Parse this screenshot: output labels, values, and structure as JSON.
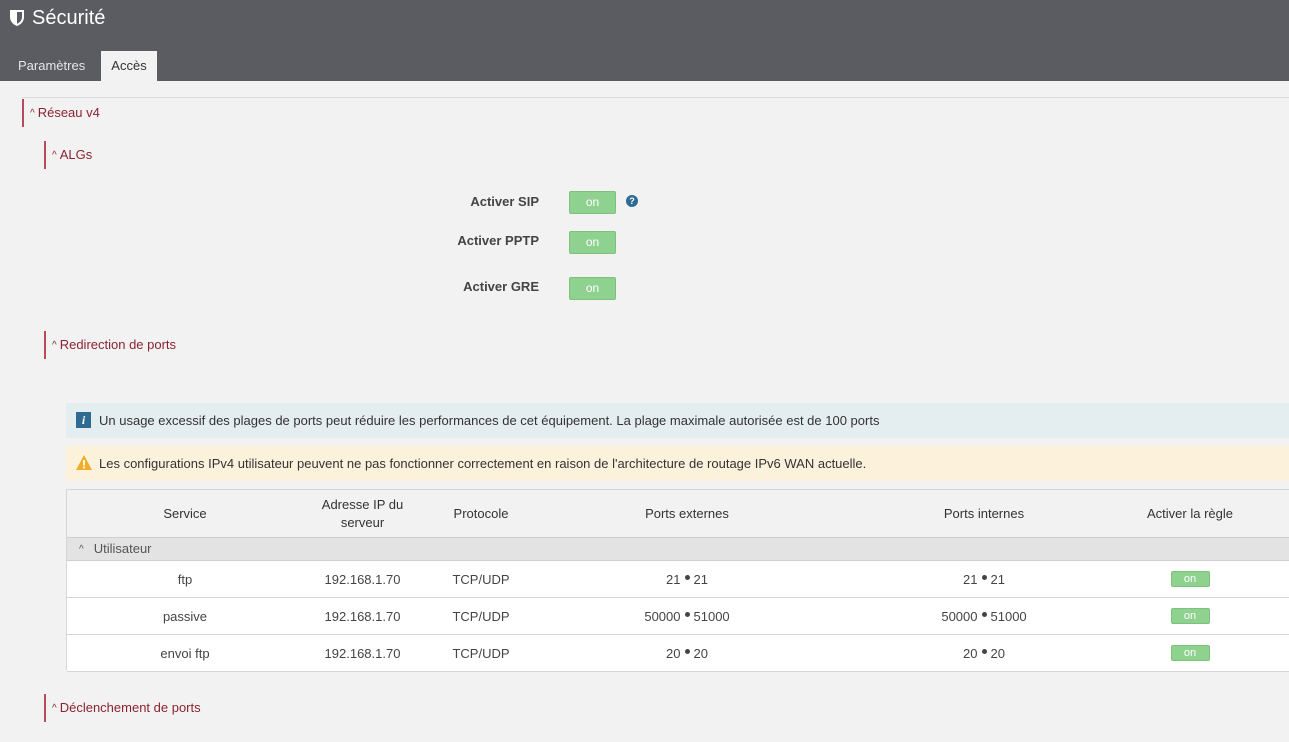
{
  "app": {
    "title": "Sécurité"
  },
  "tabs": [
    {
      "label": "Paramètres",
      "active": false
    },
    {
      "label": "Accès",
      "active": true
    }
  ],
  "sections": {
    "reseau": "Réseau v4",
    "algs": "ALGs",
    "redirection": "Redirection de ports",
    "declenchement": "Déclenchement de ports"
  },
  "algs": [
    {
      "label": "Activer SIP",
      "value": "on",
      "help": true
    },
    {
      "label": "Activer PPTP",
      "value": "on"
    },
    {
      "label": "Activer GRE",
      "value": "on"
    }
  ],
  "help_glyph": "?",
  "banners": {
    "info": "Un usage excessif des plages de ports peut réduire les performances de cet équipement. La plage maximale autorisée est de 100 ports",
    "info_icon_glyph": "i",
    "warn": "Les configurations IPv4 utilisateur peuvent ne pas fonctionner correctement en raison de l'architecture de routage IPv6 WAN actuelle."
  },
  "table": {
    "headers": {
      "service": "Service",
      "ip": "Adresse IP du serveur",
      "protocol": "Protocole",
      "ext": "Ports externes",
      "int": "Ports internes",
      "enable": "Activer la règle"
    },
    "group": "Utilisateur",
    "rows": [
      {
        "service": "ftp",
        "ip": "192.168.1.70",
        "protocol": "TCP/UDP",
        "ext_start": "21",
        "ext_end": "21",
        "int_start": "21",
        "int_end": "21",
        "enabled": "on"
      },
      {
        "service": "passive",
        "ip": "192.168.1.70",
        "protocol": "TCP/UDP",
        "ext_start": "50000",
        "ext_end": "51000",
        "int_start": "50000",
        "int_end": "51000",
        "enabled": "on"
      },
      {
        "service": "envoi ftp",
        "ip": "192.168.1.70",
        "protocol": "TCP/UDP",
        "ext_start": "20",
        "ext_end": "20",
        "int_start": "20",
        "int_end": "20",
        "enabled": "on"
      }
    ]
  },
  "colors": {
    "header_bg": "#5b5b62",
    "accent": "#8b2332",
    "toggle_on": "#8fd18f",
    "info_bg": "#e4edf0",
    "warn_bg": "#fcf2dc"
  }
}
